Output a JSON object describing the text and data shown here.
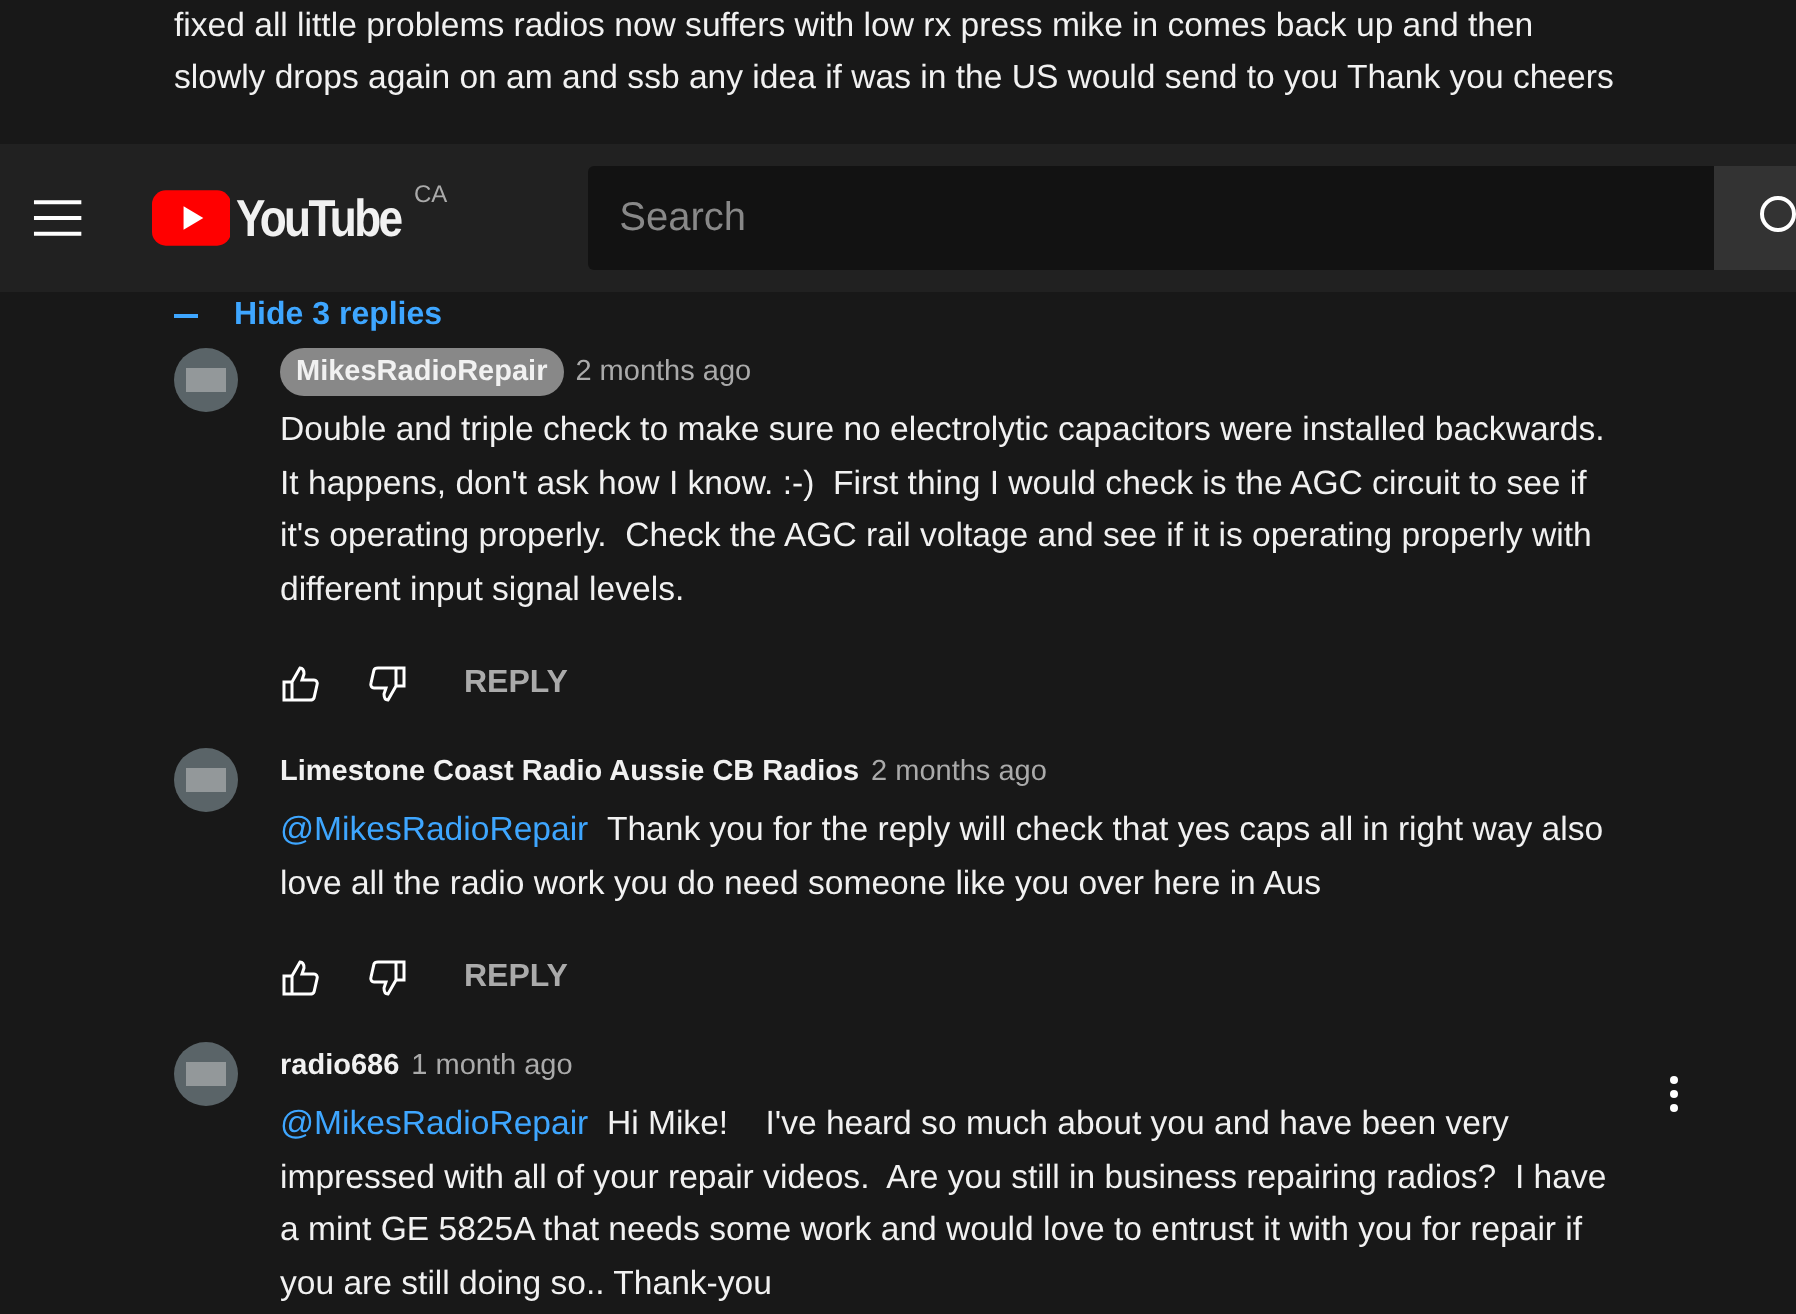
{
  "parent_comment": {
    "text": "fixed all little problems radios now suffers with low rx press mike in comes back up and then slowly drops again on am and ssb  any idea if was in the US would send to you Thank you cheers"
  },
  "header": {
    "logo_text": "YouTube",
    "country": "CA",
    "search": {
      "placeholder": "Search"
    }
  },
  "hide_replies": {
    "label": "Hide 3 replies"
  },
  "replies": [
    {
      "author": "MikesRadioRepair",
      "is_creator": true,
      "time": "2 months ago",
      "text": "Double and triple check to make sure no electrolytic capacitors were installed backwards.  It happens, don't ask how I know. :-)  First thing I would check is the AGC circuit to see if it's operating properly.  Check the AGC rail voltage and see if it is operating properly with different input signal levels.",
      "reply_label": "REPLY",
      "menu_shown": false
    },
    {
      "author": "Limestone Coast Radio Aussie CB Radios",
      "is_creator": false,
      "time": "2 months ago",
      "mention": "@MikesRadioRepair",
      "text": "Thank you for the reply will check that yes caps all in right way also love all the radio work you do need someone like you over here in Aus",
      "reply_label": "REPLY",
      "menu_shown": false
    },
    {
      "author": "radio686",
      "is_creator": false,
      "time": "1 month ago",
      "mention": "@MikesRadioRepair",
      "text": "Hi Mike!    I've heard so much about you and have been very impressed with all of your repair videos.  Are you still in business repairing radios?  I have a mint GE 5825A that needs some work and would love to entrust it with you for repair if you are still doing so.. Thank-you",
      "menu_shown": true
    }
  ]
}
